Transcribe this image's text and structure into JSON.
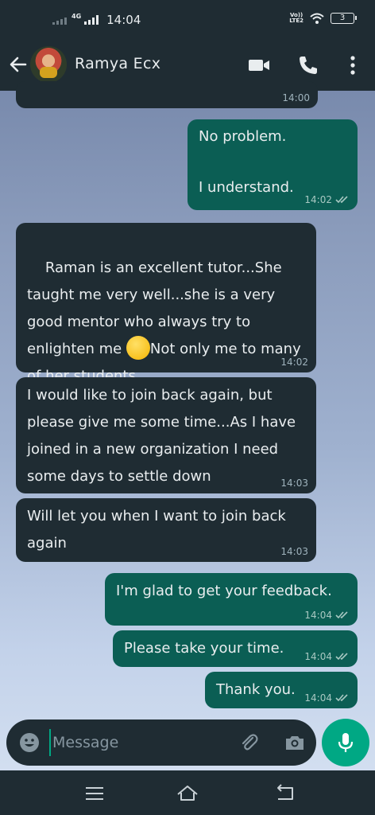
{
  "status_bar": {
    "network": "4G",
    "time": "14:04",
    "volte_top": "Vo))",
    "volte_bottom": "LTE2",
    "battery": "3"
  },
  "header": {
    "contact_name": "Ramya Ecx",
    "icons": [
      "back-arrow-icon",
      "avatar",
      "video-call-icon",
      "voice-call-icon",
      "more-options-icon"
    ]
  },
  "messages": [
    {
      "direction": "in",
      "text": "",
      "time": "14:00"
    },
    {
      "direction": "out",
      "text": "No problem.\n\nI understand.",
      "time": "14:02",
      "status": "read"
    },
    {
      "direction": "in",
      "text_before_emoji": "Raman is an excellent tutor...She taught me very well...she is a very good mentor who always try to enlighten me ",
      "emoji": "smiling-face-emoji",
      "text_after_emoji": "Not only me to many of her students...",
      "time": "14:02"
    },
    {
      "direction": "in",
      "text": "I would like to join back again, but please give me some time...As I have joined in a new organization I need some days to settle down",
      "time": "14:03"
    },
    {
      "direction": "in",
      "text": "Will let you when I want to join back again",
      "time": "14:03"
    },
    {
      "direction": "out",
      "text": "I'm glad to get your feedback.",
      "time": "14:04",
      "status": "read"
    },
    {
      "direction": "out",
      "text": "Please take your time.",
      "time": "14:04",
      "status": "read"
    },
    {
      "direction": "out",
      "text": "Thank you.",
      "time": "14:04",
      "status": "read"
    }
  ],
  "compose": {
    "placeholder": "Message",
    "icons": [
      "emoji-icon",
      "attach-icon",
      "camera-icon",
      "mic-icon"
    ]
  },
  "colors": {
    "incoming_bubble": "#1f2c33",
    "outgoing_bubble": "#0b5e54",
    "accent": "#00a884"
  }
}
